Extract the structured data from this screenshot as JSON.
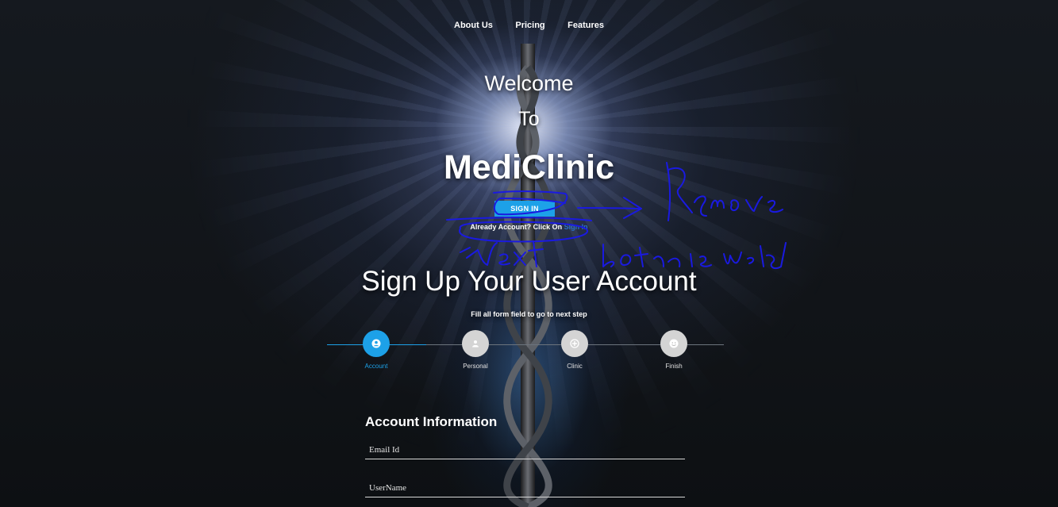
{
  "nav": {
    "items": [
      {
        "label": "About Us"
      },
      {
        "label": "Pricing"
      },
      {
        "label": "Features"
      }
    ]
  },
  "hero": {
    "welcome": "Welcome",
    "to": "To",
    "brand": "MediClinic",
    "signin_label": "SIGN IN",
    "already_text": "Already Account? Click On",
    "already_link": "Sign In"
  },
  "annotation": {
    "text_remove": "Remove",
    "text_next": "Next button is needed",
    "color": "#1a1ae0"
  },
  "signup": {
    "title": "Sign Up Your User Account",
    "subtitle": "Fill all form field to go to next step"
  },
  "steps": [
    {
      "label": "Account",
      "icon": "account-icon",
      "active": true
    },
    {
      "label": "Personal",
      "icon": "person-icon",
      "active": false
    },
    {
      "label": "Clinic",
      "icon": "clinic-icon",
      "active": false
    },
    {
      "label": "Finish",
      "icon": "finish-icon",
      "active": false
    }
  ],
  "form": {
    "title": "Account Information",
    "email_placeholder": "Email Id",
    "username_placeholder": "UserName"
  },
  "colors": {
    "accent": "#1da1e8",
    "step_inactive": "#d4d4d4",
    "background": "#111418"
  }
}
